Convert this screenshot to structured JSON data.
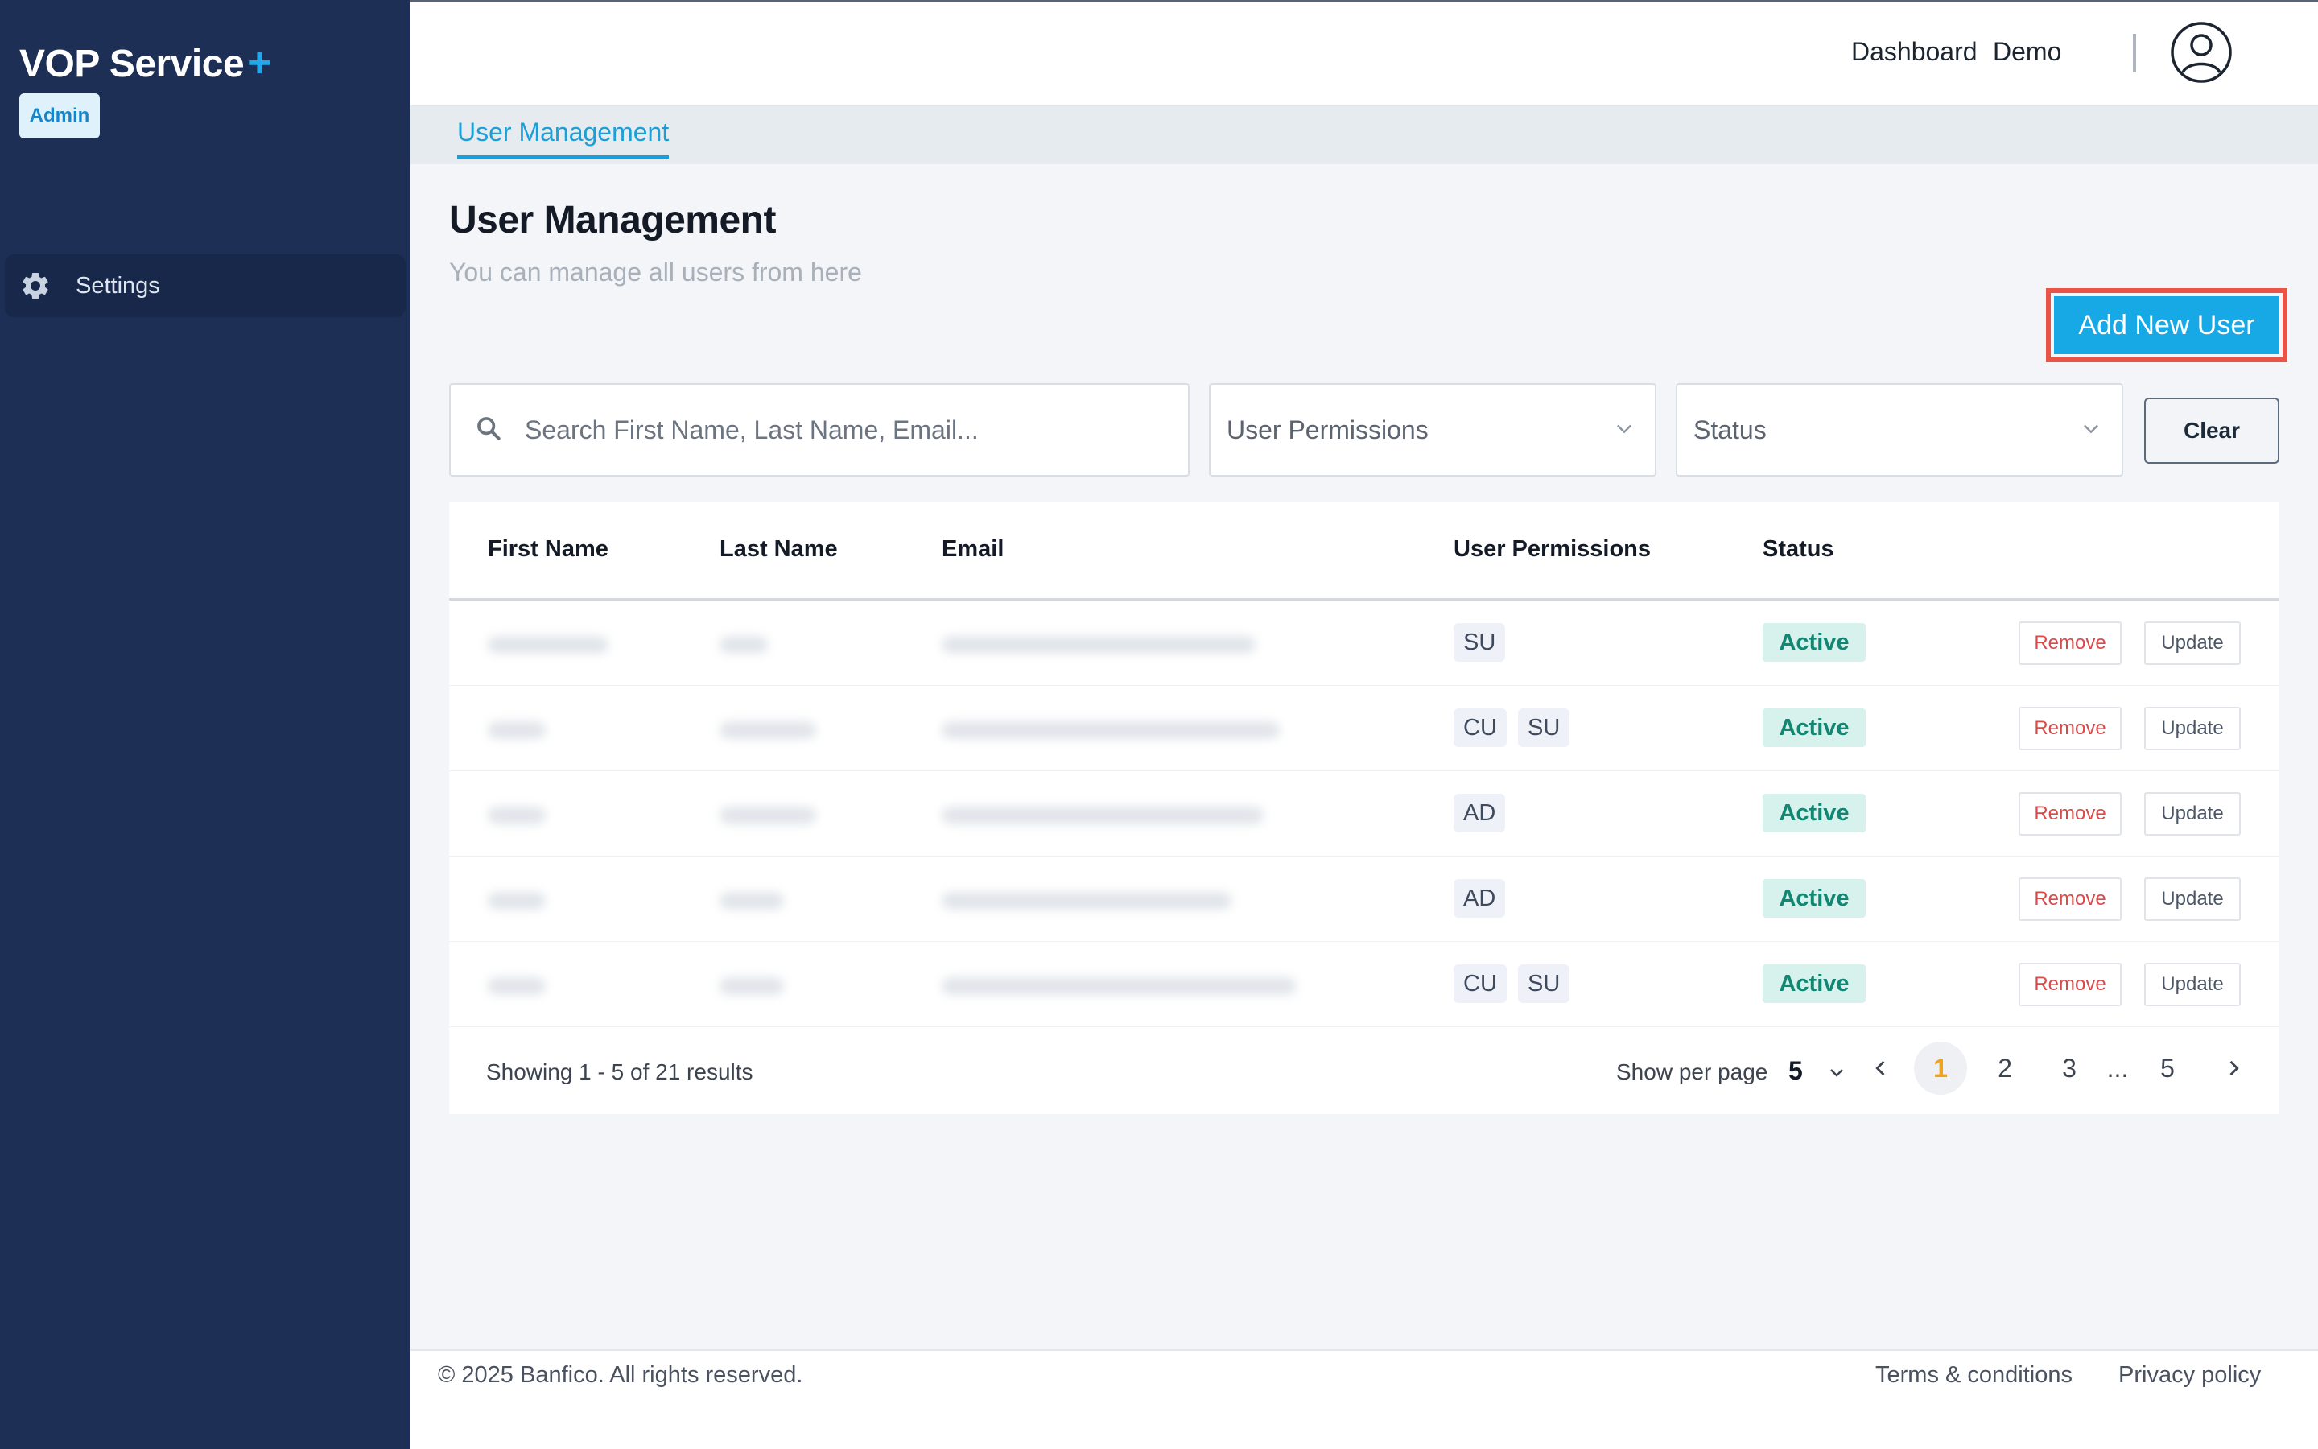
{
  "sidebar": {
    "brand": "VOP Service",
    "brand_plus": "+",
    "role_badge": "Admin",
    "items": [
      {
        "label": "Settings",
        "icon": "gear-icon"
      }
    ]
  },
  "topbar": {
    "links": [
      "Dashboard",
      "Demo"
    ],
    "avatar_icon": "user-avatar-icon"
  },
  "tabs": [
    {
      "label": "User Management",
      "active": true
    }
  ],
  "header": {
    "title": "User Management",
    "subtitle": "You can manage all users from here",
    "add_button": "Add New User"
  },
  "filters": {
    "search_placeholder": "Search First Name, Last Name, Email...",
    "permissions_select": "User Permissions",
    "status_select": "Status",
    "clear_button": "Clear"
  },
  "table": {
    "columns": [
      "First Name",
      "Last Name",
      "Email",
      "User Permissions",
      "Status"
    ],
    "rows": [
      {
        "permissions": [
          "SU"
        ],
        "status": "Active",
        "remove": "Remove",
        "update": "Update"
      },
      {
        "permissions": [
          "CU",
          "SU"
        ],
        "status": "Active",
        "remove": "Remove",
        "update": "Update"
      },
      {
        "permissions": [
          "AD"
        ],
        "status": "Active",
        "remove": "Remove",
        "update": "Update"
      },
      {
        "permissions": [
          "AD"
        ],
        "status": "Active",
        "remove": "Remove",
        "update": "Update"
      },
      {
        "permissions": [
          "CU",
          "SU"
        ],
        "status": "Active",
        "remove": "Remove",
        "update": "Update"
      }
    ]
  },
  "pagination": {
    "showing": "Showing 1 - 5 of 21 results",
    "per_page_label": "Show per page",
    "per_page_value": "5",
    "pages": [
      "1",
      "2",
      "3",
      "...",
      "5"
    ],
    "current_page": "1"
  },
  "footer": {
    "copyright": "© 2025 Banfico. All rights reserved.",
    "terms": "Terms & conditions",
    "privacy": "Privacy policy"
  },
  "colors": {
    "sidebar_bg": "#1d2f55",
    "accent": "#17a8e6",
    "active_status_bg": "#d7f2ec",
    "active_status_text": "#118672",
    "remove_text": "#d94a4a",
    "current_page": "#f0a21a"
  }
}
